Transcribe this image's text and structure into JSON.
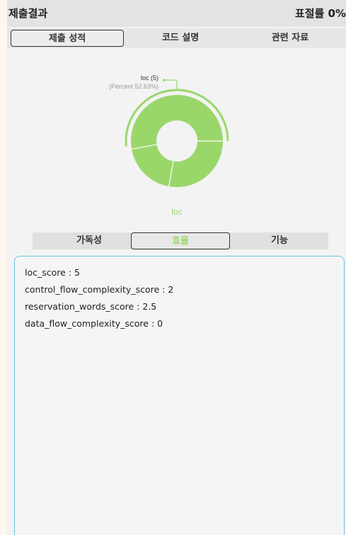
{
  "header": {
    "title": "제출결과",
    "rate": "표절률 0%"
  },
  "tabs": [
    {
      "label": "제출 성적",
      "active": true
    },
    {
      "label": "코드 설명",
      "active": false
    },
    {
      "label": "관련 자료",
      "active": false
    }
  ],
  "chart_data": {
    "type": "pie",
    "categories": [
      "loc"
    ],
    "values": [
      5
    ],
    "percent": [
      52.63
    ],
    "tooltip": {
      "label": "loc (5)",
      "percent": "(Percent 52.63%)"
    },
    "center_label": "loc",
    "colors": {
      "slice": "#9ad76b"
    }
  },
  "subtabs": [
    {
      "label": "가독성",
      "active": false
    },
    {
      "label": "효율",
      "active": true
    },
    {
      "label": "기능",
      "active": false
    }
  ],
  "scores": [
    "loc_score : 5",
    "control_flow_complexity_score : 2",
    "reservation_words_score : 2.5",
    "data_flow_complexity_score : 0"
  ],
  "colors": {
    "accent_green": "#9ad76b",
    "box_border": "#6cc3e6"
  }
}
